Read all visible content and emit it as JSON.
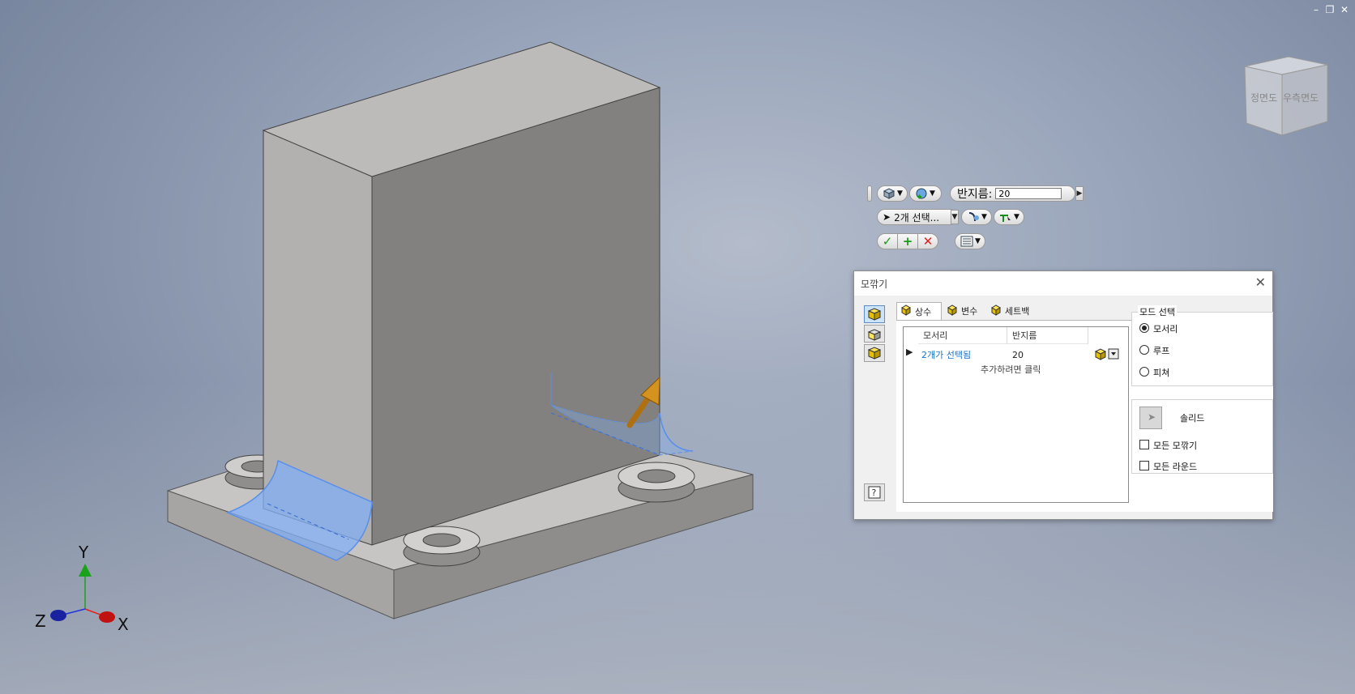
{
  "viewcube": {
    "front_label": "정면도",
    "right_label": "우측면도"
  },
  "axes": {
    "x_label": "X",
    "y_label": "Y",
    "z_label": "Z",
    "x_color": "#e0231f",
    "y_color": "#1aa31a",
    "z_color": "#2233dd"
  },
  "mini_toolbar": {
    "radius_label": "반지름:",
    "radius_value": "20",
    "selection_label": "2개 선택..."
  },
  "dialog": {
    "title": "모깎기",
    "tabs": [
      {
        "label": "상수",
        "active": true
      },
      {
        "label": "변수",
        "active": false
      },
      {
        "label": "세트백",
        "active": false
      }
    ],
    "grid": {
      "col_edge": "모서리",
      "col_radius": "반지름",
      "row_edge": "2개가 선택됨",
      "row_radius": "20",
      "add_prompt": "추가하려면 클릭"
    },
    "mode_group": {
      "title": "모드 선택",
      "options": [
        {
          "label": "모서리",
          "checked": true
        },
        {
          "label": "루프",
          "checked": false
        },
        {
          "label": "피쳐",
          "checked": false
        }
      ]
    },
    "solid_label": "솔리드",
    "checks": [
      {
        "label": "모든 모깎기",
        "checked": false
      },
      {
        "label": "모든 라운드",
        "checked": false
      }
    ],
    "accent_color": "#1a73c8"
  }
}
